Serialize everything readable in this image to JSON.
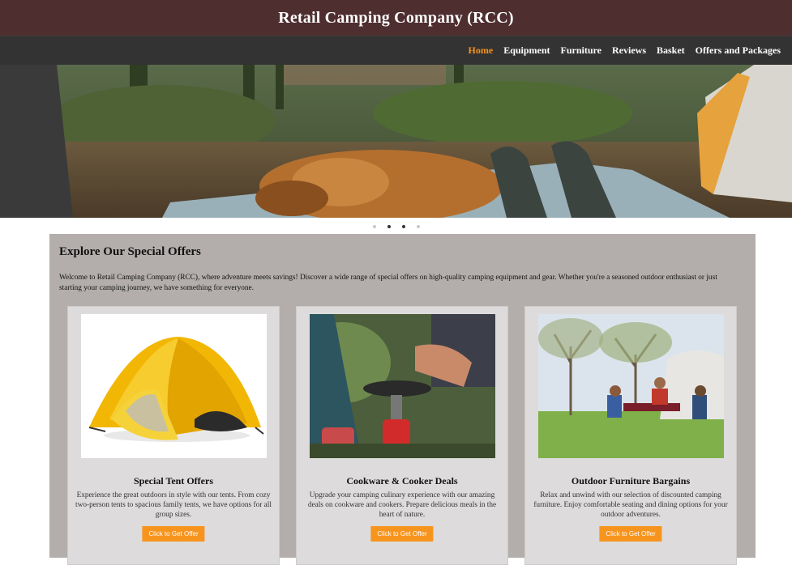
{
  "header": {
    "title": "Retail Camping Company (RCC)"
  },
  "nav": {
    "items": [
      {
        "label": "Home",
        "active": true
      },
      {
        "label": "Equipment"
      },
      {
        "label": "Furniture"
      },
      {
        "label": "Reviews"
      },
      {
        "label": "Basket"
      },
      {
        "label": "Offers and Packages"
      }
    ]
  },
  "carousel": {
    "slide_count": 4,
    "active_index": 1
  },
  "offers": {
    "title": "Explore Our Special Offers",
    "intro": "Welcome to Retail Camping Company (RCC), where adventure meets savings! Discover a wide range of special offers on high-quality camping equipment and gear. Whether you're a seasoned outdoor enthusiast or just starting your camping journey, we have something for everyone.",
    "cards": [
      {
        "title": "Special Tent Offers",
        "description": "Experience the great outdoors in style with our tents. From cozy two-person tents to spacious family tents, we have options for all group sizes.",
        "button": "Click to Get Offer"
      },
      {
        "title": "Cookware & Cooker Deals",
        "description": "Upgrade your camping culinary experience with our amazing deals on cookware and cookers. Prepare delicious meals in the heart of nature.",
        "button": "Click to Get Offer"
      },
      {
        "title": "Outdoor Furniture Bargains",
        "description": "Relax and unwind with our selection of discounted camping furniture. Enjoy comfortable seating and dining options for your outdoor adventures.",
        "button": "Click to Get Offer"
      }
    ]
  },
  "colors": {
    "header_bg": "#4e2e2f",
    "nav_bg": "#333333",
    "accent": "#f7941d",
    "panel_bg": "#b3aeac",
    "card_bg": "#dddbdb"
  }
}
